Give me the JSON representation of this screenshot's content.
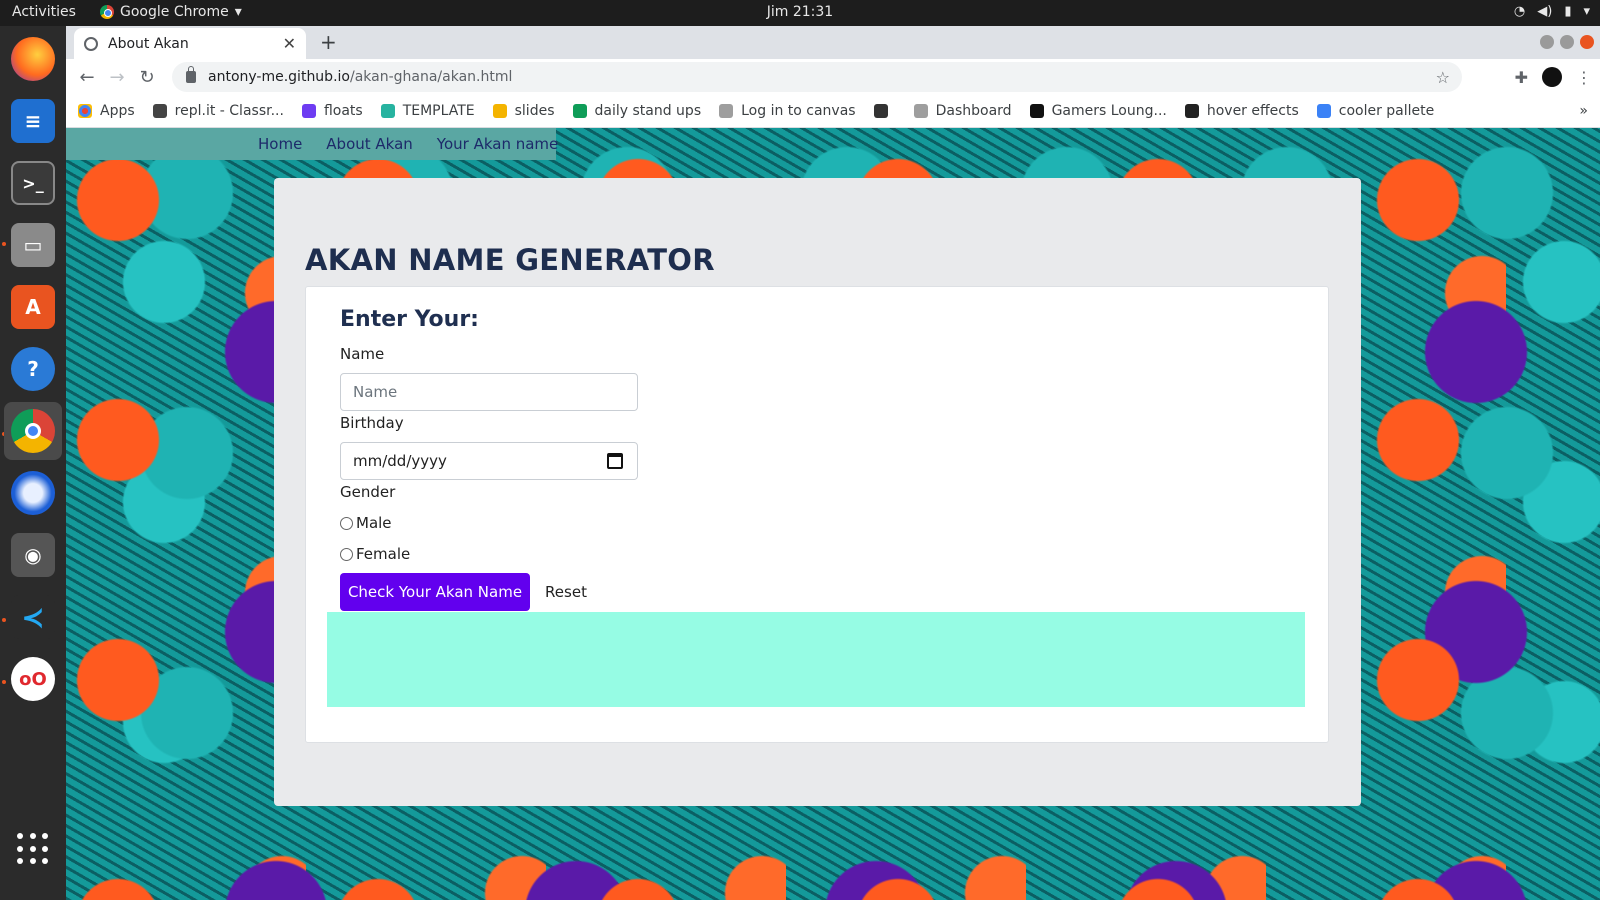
{
  "system": {
    "activities": "Activities",
    "app_name": "Google Chrome",
    "clock": "Jim 21:31"
  },
  "browser": {
    "tab_title": "About Akan",
    "url_host": "antony-me.github.io",
    "url_path": "/akan-ghana/akan.html",
    "bookmarks": [
      {
        "label": "Apps",
        "color": "#ea4335"
      },
      {
        "label": "repl.it - Classr...",
        "color": "#444444"
      },
      {
        "label": "floats",
        "color": "#6e3cf2"
      },
      {
        "label": "TEMPLATE",
        "color": "#27b3a0"
      },
      {
        "label": "slides",
        "color": "#f4b400"
      },
      {
        "label": "daily stand ups",
        "color": "#0f9d58"
      },
      {
        "label": "Log in to canvas",
        "color": "#9e9e9e"
      },
      {
        "label": "",
        "color": "#333333"
      },
      {
        "label": "Dashboard",
        "color": "#9e9e9e"
      },
      {
        "label": "Gamers Loung...",
        "color": "#111111"
      },
      {
        "label": "hover effects",
        "color": "#222222"
      },
      {
        "label": "cooler pallete",
        "color": "#3b82f6"
      }
    ],
    "bookmarks_more": "»"
  },
  "nav": {
    "home": "Home",
    "about": "About Akan",
    "your_name": "Your Akan name"
  },
  "main": {
    "title": "AKAN NAME GENERATOR",
    "form_heading": "Enter Your:",
    "name_label": "Name",
    "name_placeholder": "Name",
    "birthday_label": "Birthday",
    "birthday_value": "mm/dd/yyyy",
    "gender_label": "Gender",
    "gender_male": "Male",
    "gender_female": "Female",
    "submit_label": "Check Your Akan Name",
    "reset_label": "Reset"
  },
  "colors": {
    "accent_button": "#6200ee",
    "result_box": "#96fce4",
    "title": "#1e2e4f"
  }
}
